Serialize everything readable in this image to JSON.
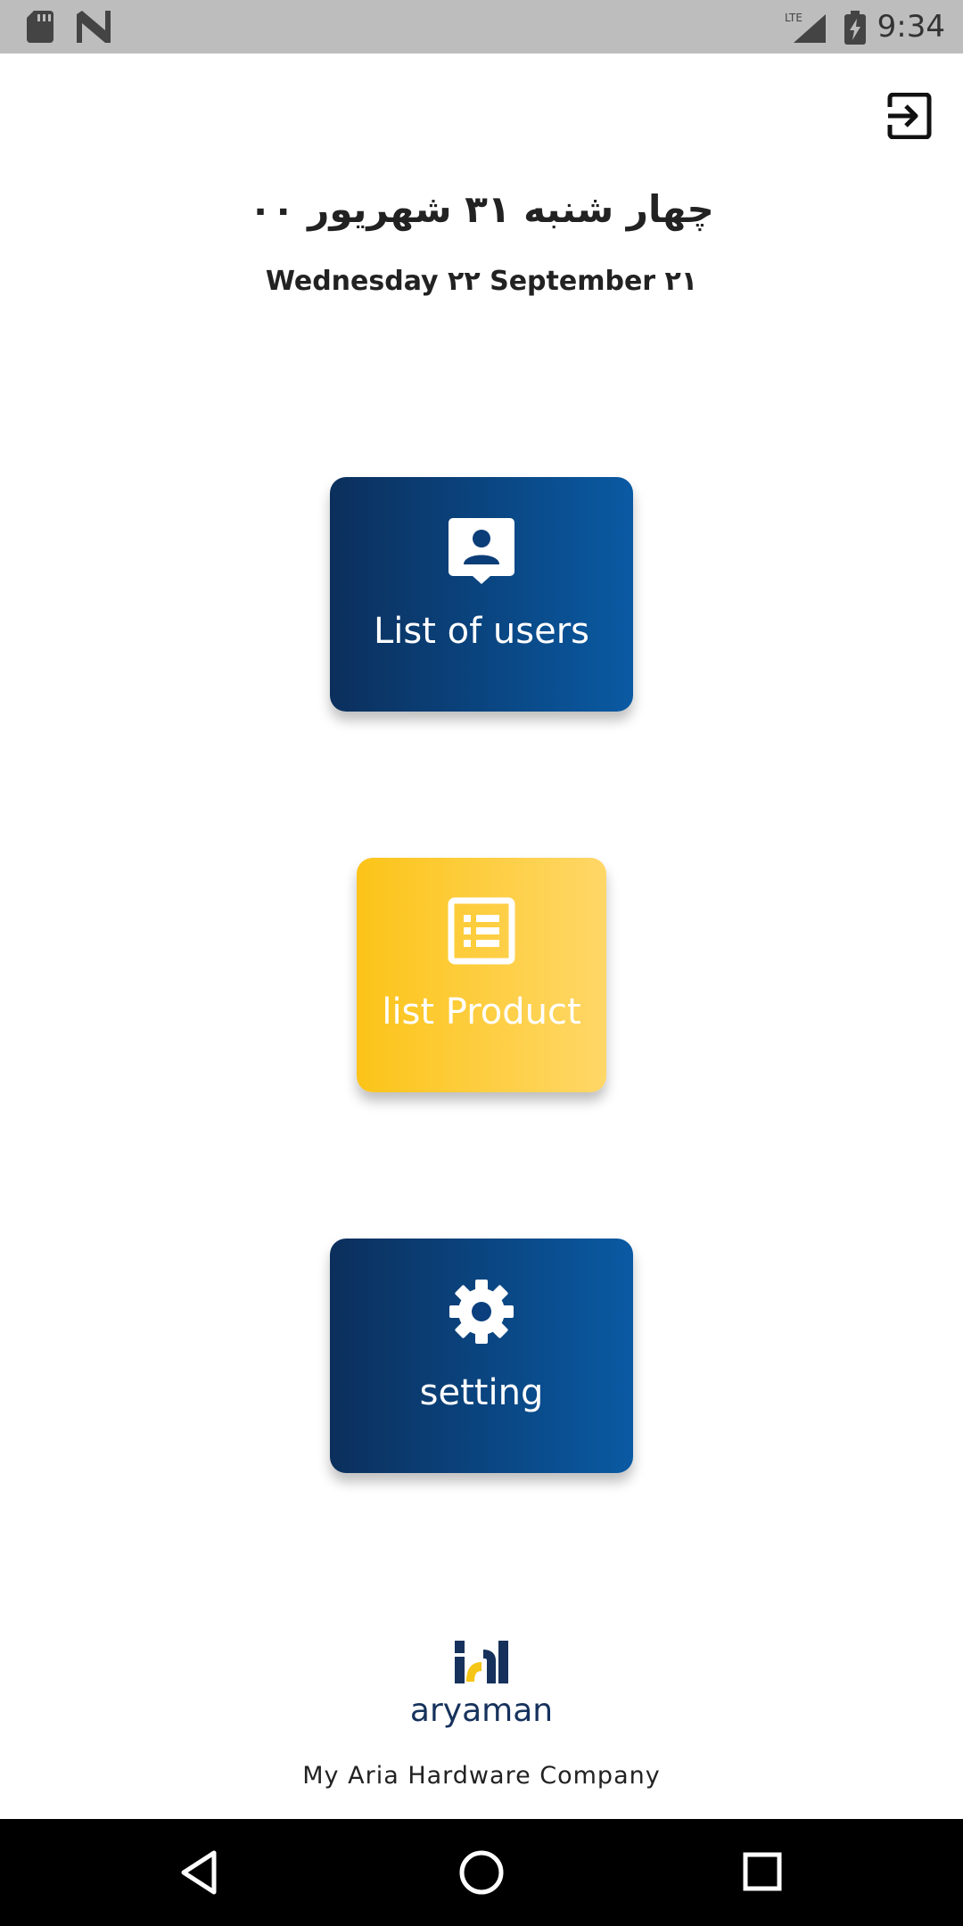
{
  "status_bar": {
    "time": "9:34",
    "network": "LTE",
    "icons": [
      "sd-card-icon",
      "n-notification-icon",
      "lte-signal-icon",
      "battery-charging-icon"
    ]
  },
  "header": {
    "logout_icon": "logout-icon",
    "date_persian": "چهار شنبه ۳۱ شهریور ۰۰",
    "date_gregorian": "Wednesday ۲۲ September ۲۱"
  },
  "menu": {
    "users": {
      "label": "List of users",
      "icon": "contact-user-icon",
      "color": "#0b2f5c"
    },
    "products": {
      "label": "list Product",
      "icon": "list-icon",
      "color": "#fcc419"
    },
    "settings": {
      "label": "setting",
      "icon": "gear-icon",
      "color": "#0b2f5c"
    }
  },
  "footer": {
    "logo_text": "aryaman",
    "company": "My Aria Hardware Company"
  },
  "nav_bar": {
    "icons": [
      "back-icon",
      "home-icon",
      "recents-icon"
    ]
  }
}
